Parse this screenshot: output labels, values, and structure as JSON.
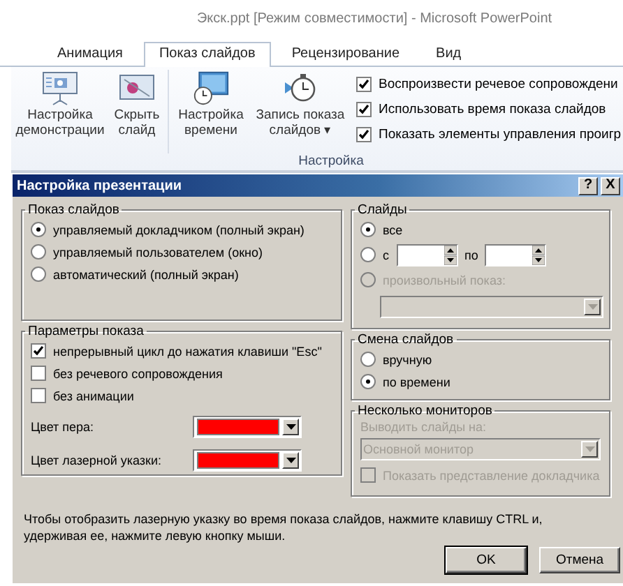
{
  "app": {
    "title": "Экск.ppt [Режим совместимости]  -  Microsoft PowerPoint",
    "tabs": [
      {
        "label": "Анимация",
        "selected": false
      },
      {
        "label": "Показ слайдов",
        "selected": true
      },
      {
        "label": "Рецензирование",
        "selected": false
      },
      {
        "label": "Вид",
        "selected": false
      }
    ],
    "ribbon": {
      "buttons": [
        {
          "kind": "setup",
          "label": "Настройка демонстрации"
        },
        {
          "kind": "hide",
          "label": "Скрыть слайд"
        },
        {
          "kind": "timing",
          "label": "Настройка времени"
        },
        {
          "kind": "record",
          "label": "Запись показа слайдов",
          "dropdown": "▾"
        }
      ],
      "options": [
        {
          "label": "Воспроизвести речевое сопровождени",
          "checked": true
        },
        {
          "label": "Использовать время показа слайдов",
          "checked": true
        },
        {
          "label": "Показать элементы управления проигр",
          "checked": true
        }
      ],
      "group_label": "Настройка"
    }
  },
  "dialog": {
    "title": "Настройка презентации",
    "help": "?",
    "close": "X",
    "show_type": {
      "title": "Показ слайдов",
      "options": [
        {
          "label": "управляемый докладчиком (полный экран)",
          "selected": true
        },
        {
          "label": "управляемый пользователем (окно)",
          "selected": false
        },
        {
          "label": "автоматический (полный экран)",
          "selected": false
        }
      ]
    },
    "show_options": {
      "title": "Параметры показа",
      "options": [
        {
          "label": "непрерывный цикл до нажатия клавиши \"Esc\"",
          "checked": true
        },
        {
          "label": "без речевого сопровождения",
          "checked": false
        },
        {
          "label": "без анимации",
          "checked": false
        }
      ],
      "colors": [
        {
          "label": "Цвет пера:",
          "color": "#ff0000"
        },
        {
          "label": "Цвет лазерной указки:",
          "color": "#ff0000"
        }
      ]
    },
    "slides": {
      "title": "Слайды",
      "options": [
        {
          "kind": "all",
          "label": "все",
          "selected": true,
          "disabled": false
        },
        {
          "kind": "range",
          "label": "с",
          "to_label": "по",
          "selected": false,
          "disabled": false
        },
        {
          "kind": "custom",
          "label": "произвольный показ:",
          "selected": false,
          "disabled": true
        }
      ]
    },
    "advance": {
      "title": "Смена слайдов",
      "options": [
        {
          "label": "вручную",
          "selected": false
        },
        {
          "label": "по времени",
          "selected": true
        }
      ]
    },
    "monitors": {
      "title": "Несколько мониторов",
      "target_label": "Выводить слайды на:",
      "target_value": "Основной монитор",
      "disabled": true,
      "presenter_view": {
        "label": "Показать представление докладчика",
        "checked": false,
        "disabled": true
      }
    },
    "hint": "Чтобы отобразить лазерную указку во время показа слайдов, нажмите клавишу CTRL и, удерживая ее, нажмите левую кнопку мыши.",
    "buttons": [
      {
        "kind": "ok",
        "label": "OK"
      },
      {
        "kind": "cancel",
        "label": "Отмена"
      }
    ]
  }
}
